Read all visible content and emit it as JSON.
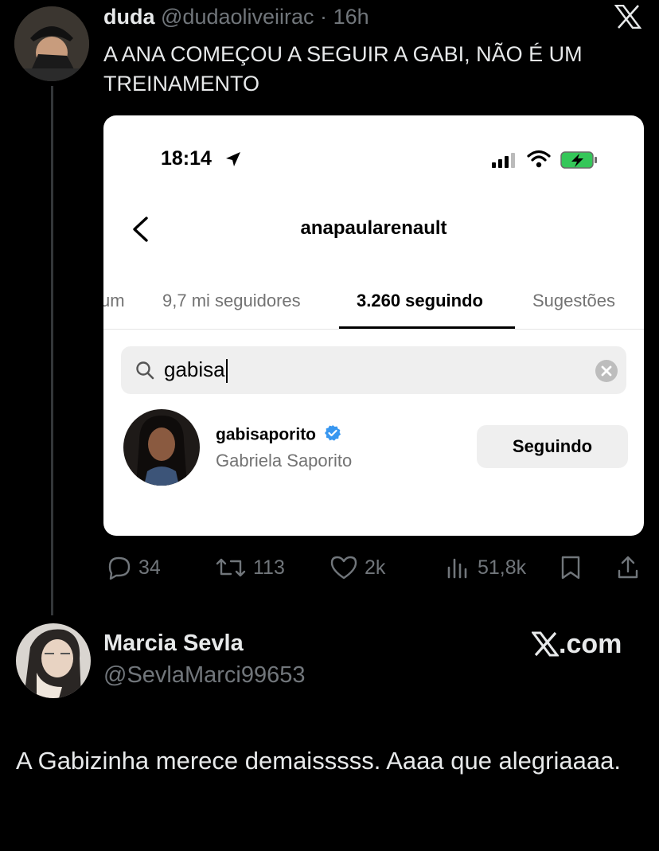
{
  "tweet": {
    "author_name": "duda",
    "handle": "@dudaoliveiirac",
    "separator": "·",
    "time": "16h",
    "text": "A ANA COMEÇOU A SEGUIR A GABI, NÃO É UM TREINAMENTO",
    "stats": {
      "replies": "34",
      "retweets": "113",
      "likes": "2k",
      "views": "51,8k"
    }
  },
  "screenshot": {
    "time": "18:14",
    "username": "anapaulArenault",
    "tabs": [
      "um",
      "9,7 mi seguidores",
      "3.260 seguindo",
      "Sugestões"
    ],
    "active_tab": "3.260 seguindo",
    "search_value": "gabisa",
    "result": {
      "username": "gabisaporito",
      "full_name": "Gabriela Saporito",
      "button_label": "Seguindo"
    }
  },
  "reply": {
    "author_name": "Marcia Sevla",
    "handle": "@SevlaMarci99653",
    "text": "A Gabizinha merece demaisssss. Aaaa que alegriaaaa."
  },
  "branding": {
    "watermark": ".com"
  },
  "colors": {
    "background": "#000000",
    "text": "#e7e9ea",
    "muted": "#71767b",
    "verified": "#3897f0"
  }
}
